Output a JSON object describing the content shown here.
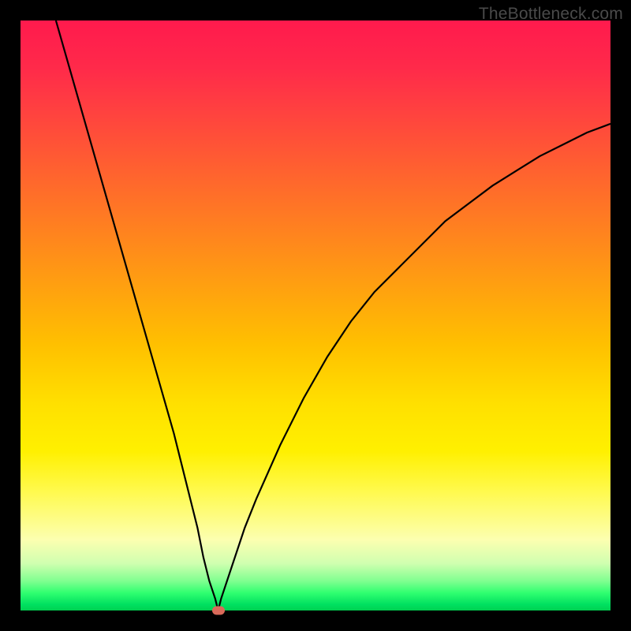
{
  "watermark": "TheBottleneck.com",
  "chart_data": {
    "type": "line",
    "title": "",
    "xlabel": "",
    "ylabel": "",
    "xlim": [
      0,
      100
    ],
    "ylim": [
      0,
      100
    ],
    "background_gradient": {
      "top": "#ff1a4d",
      "bottom": "#00d050",
      "meaning": "red=high bottleneck, green=low bottleneck"
    },
    "series": [
      {
        "name": "bottleneck-curve",
        "x": [
          6,
          8,
          10,
          12,
          14,
          16,
          18,
          20,
          22,
          24,
          26,
          28,
          30,
          31,
          32,
          33,
          33.5,
          34,
          36,
          38,
          40,
          44,
          48,
          52,
          56,
          60,
          64,
          68,
          72,
          76,
          80,
          84,
          88,
          92,
          96,
          100
        ],
        "values": [
          100,
          93,
          86,
          79,
          72,
          65,
          58,
          51,
          44,
          37,
          30,
          22,
          14,
          9,
          5,
          2,
          0,
          2,
          8,
          14,
          19,
          28,
          36,
          43,
          49,
          54,
          58,
          62,
          66,
          69,
          72,
          74.5,
          77,
          79,
          81,
          82.5
        ]
      }
    ],
    "marker": {
      "x": 33.5,
      "y": 0,
      "color": "#d96a5a"
    }
  }
}
